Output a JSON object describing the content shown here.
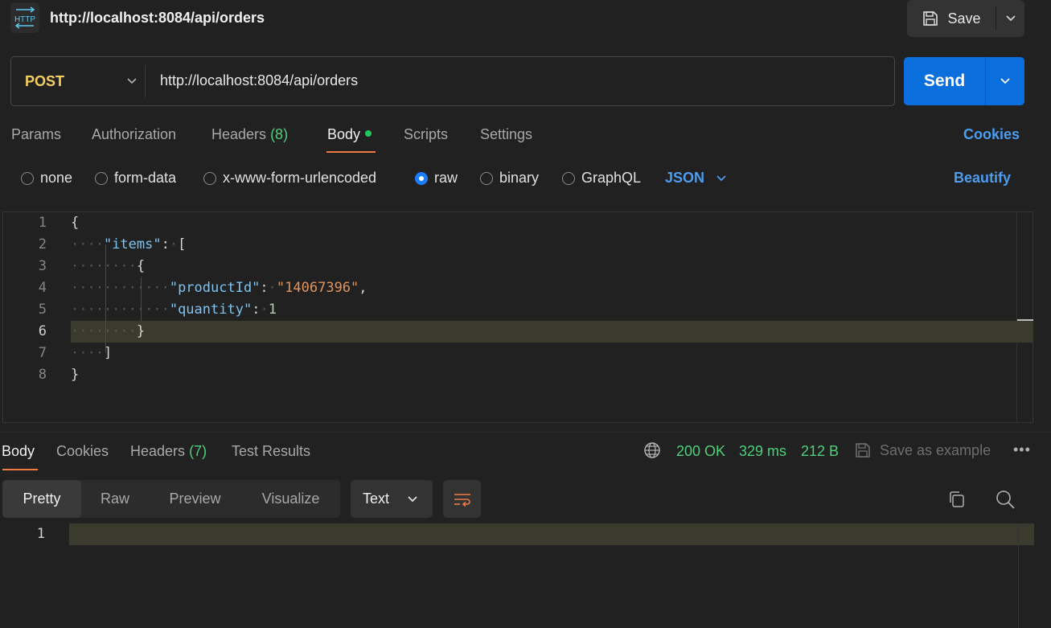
{
  "request": {
    "title": "http://localhost:8084/api/orders",
    "save_label": "Save",
    "method": "POST",
    "url": "http://localhost:8084/api/orders",
    "send_label": "Send"
  },
  "tabs": [
    {
      "label": "Params"
    },
    {
      "label": "Authorization"
    },
    {
      "label": "Headers",
      "count": "(8)"
    },
    {
      "label": "Body"
    },
    {
      "label": "Scripts"
    },
    {
      "label": "Settings"
    }
  ],
  "cookies_label": "Cookies",
  "body_types": [
    "none",
    "form-data",
    "x-www-form-urlencoded",
    "raw",
    "binary",
    "GraphQL"
  ],
  "selected_body_type": "raw",
  "format": "JSON",
  "beautify_label": "Beautify",
  "editor": {
    "line_numbers": [
      "1",
      "2",
      "3",
      "4",
      "5",
      "6",
      "7",
      "8"
    ],
    "current_line": "6",
    "tokens": {
      "open_brace": "{",
      "items_key": "\"items\"",
      "colon": ":",
      "open_bracket": "[",
      "inner_open": "{",
      "product_key": "\"productId\"",
      "product_val": "\"14067396\"",
      "comma": ",",
      "quantity_key": "\"quantity\"",
      "quantity_val": "1",
      "inner_close": "}",
      "close_bracket": "]",
      "close_brace": "}"
    }
  },
  "response": {
    "tabs": [
      {
        "label": "Body"
      },
      {
        "label": "Cookies"
      },
      {
        "label": "Headers",
        "count": "(7)"
      },
      {
        "label": "Test Results"
      }
    ],
    "status": "200 OK",
    "time": "329 ms",
    "size": "212 B",
    "save_example_label": "Save as example",
    "more_label": "•••",
    "views": [
      "Pretty",
      "Raw",
      "Preview",
      "Visualize"
    ],
    "text_format": "Text",
    "line_number": "1"
  },
  "colors": {
    "accent_orange": "#ef7a45",
    "send_blue": "#0a6fdc",
    "method_yellow": "#f5cf5e",
    "success_green": "#4fcf7a",
    "link_blue": "#4d9cf0"
  }
}
